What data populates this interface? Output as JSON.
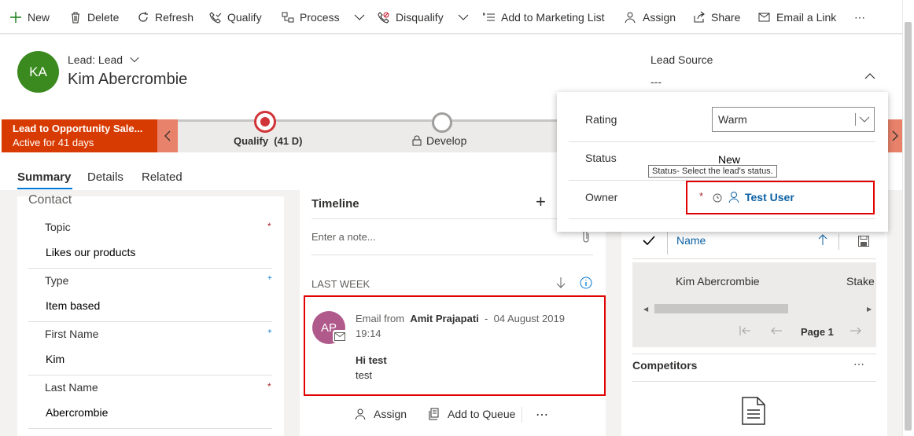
{
  "toolbar": {
    "new": "New",
    "delete": "Delete",
    "refresh": "Refresh",
    "qualify": "Qualify",
    "process": "Process",
    "disqualify": "Disqualify",
    "add_marketing": "Add to Marketing List",
    "assign": "Assign",
    "share": "Share",
    "email_link": "Email a Link",
    "more": "⋯"
  },
  "header": {
    "avatar_initials": "KA",
    "entity": "Lead: Lead",
    "name": "Kim Abercrombie",
    "lead_source_label": "Lead Source",
    "lead_source_value": "---"
  },
  "process": {
    "active_title": "Lead to Opportunity Sale...",
    "active_sub": "Active for 41 days",
    "stage1": "Qualify  (41 D)",
    "stage2": "Develop"
  },
  "tabs": [
    "Summary",
    "Details",
    "Related"
  ],
  "contact": {
    "section": "Contact",
    "fields": [
      {
        "label": "Topic",
        "value": "Likes our products",
        "marker": "*"
      },
      {
        "label": "Type",
        "value": "Item based",
        "marker": "+"
      },
      {
        "label": "First Name",
        "value": "Kim",
        "marker": "+"
      },
      {
        "label": "Last Name",
        "value": "Abercrombie",
        "marker": "*"
      }
    ]
  },
  "timeline": {
    "title": "Timeline",
    "add": "+",
    "note_placeholder": "Enter a note...",
    "group": "LAST WEEK",
    "item": {
      "initials": "AP",
      "prefix": "Email from",
      "sender": "Amit Prajapati",
      "sep": "-",
      "date": "04 August 2019",
      "time": "19:14",
      "subject": "Hi test",
      "body": "test"
    },
    "actions": {
      "assign": "Assign",
      "queue": "Add to Queue",
      "more": "⋯"
    }
  },
  "stakeholders": {
    "col_name": "Name",
    "row_name": "Kim Abercrombie",
    "row_partial": "Stake",
    "page": "Page 1"
  },
  "competitors": {
    "title": "Competitors",
    "more": "⋯"
  },
  "flyout": {
    "rating_label": "Rating",
    "rating_value": "Warm",
    "status_label": "Status",
    "status_value": "New",
    "tooltip": "Status- Select the lead's status.",
    "owner_label": "Owner",
    "owner_req": "*",
    "owner_value": "Test User"
  },
  "colors": {
    "accent": "#0078d4",
    "brand": "#d83b01",
    "red_box": "#e00000"
  }
}
